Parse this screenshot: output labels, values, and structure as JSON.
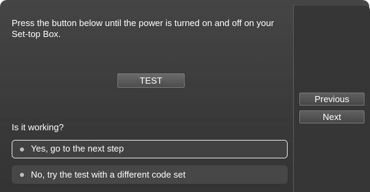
{
  "instruction": "Press the button below until the power is turned on and off on your Set-top Box.",
  "test_button": "TEST",
  "question": "Is it working?",
  "options": [
    {
      "label": "Yes, go to the next step",
      "selected": true
    },
    {
      "label": "No, try the test with a different code set",
      "selected": false
    }
  ],
  "nav": {
    "previous": "Previous",
    "next": "Next"
  },
  "colors": {
    "panel": "#3c3c3c",
    "side_panel": "#363636",
    "text": "#ffffff",
    "selection_border": "#e6e6e6"
  }
}
